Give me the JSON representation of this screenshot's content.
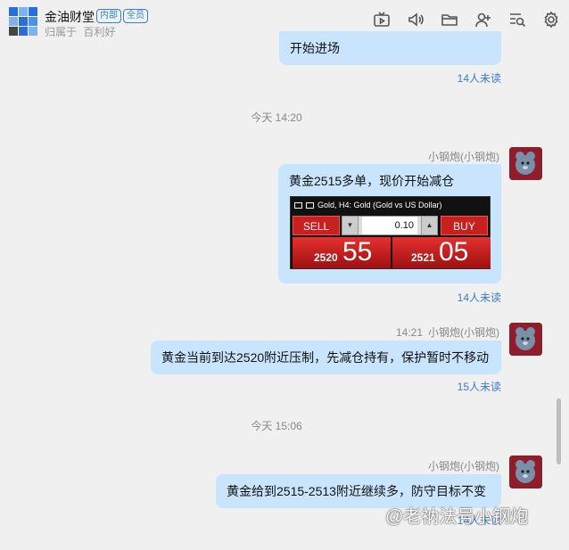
{
  "header": {
    "title": "金油财堂",
    "tags": [
      "内部",
      "全员"
    ],
    "subtitle_prefix": "归属于",
    "subtitle_owner": "百利好",
    "icons": [
      "live-tv-icon",
      "speaker-icon",
      "folder-icon",
      "add-user-icon",
      "search-list-icon",
      "settings-gear-icon"
    ]
  },
  "messages": [
    {
      "text": "开始进场",
      "unread": "14人未读"
    },
    {
      "time_sep": "今天 14:20"
    },
    {
      "sender": "小钢炮(小钢炮)",
      "text": "黄金2515多单，现价开始减仓",
      "trade": {
        "title": "Gold, H4:  Gold (Gold vs US Dollar)",
        "sell_label": "SELL",
        "buy_label": "BUY",
        "lot": "0.10",
        "sell_small": "2520",
        "sell_big": "55",
        "buy_small": "2521",
        "buy_big": "05"
      },
      "unread": "14人未读"
    },
    {
      "time": "14:21",
      "sender": "小钢炮(小钢炮)",
      "text": "黄金当前到达2520附近压制，先减仓持有，保护暂时不移动",
      "unread": "15人未读"
    },
    {
      "time_sep": "今天 15:06"
    },
    {
      "sender": "小钢炮(小钢炮)",
      "text": "黄金给到2515-2513附近继续多，防守目标不变",
      "unread": "14人未读"
    }
  ],
  "watermark": "@老衲法号小钢炮",
  "colors": {
    "bubble": "#c9e5fd",
    "link": "#3a7bd5",
    "trade_red": "#c81f1f"
  }
}
